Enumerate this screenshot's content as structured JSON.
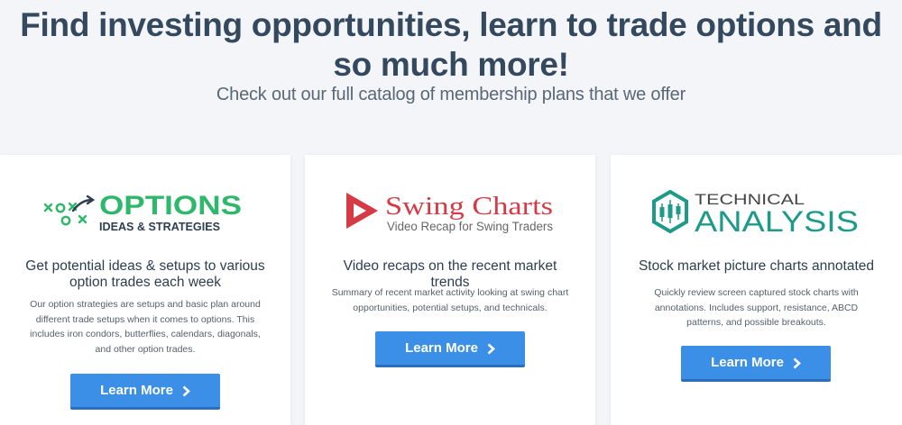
{
  "hero": {
    "headline": "Find investing opportunities, learn to trade options and so much more!",
    "subheadline": "Check out our full catalog of membership plans that we offer"
  },
  "plans": [
    {
      "logo": {
        "word": "OPTIONS",
        "tagline": "IDEAS & STRATEGIES",
        "word_color": "#2fb86b",
        "tagline_color": "#2c3e50",
        "icon": "xo-play-icon"
      },
      "title": "Get potential ideas & setups to various option trades each week",
      "description": "Our option strategies are setups and basic plan around different trade setups when it comes to options. This includes iron condors, butterflies, calendars, diagonals, and other option trades.",
      "button_label": "Learn More"
    },
    {
      "logo": {
        "word": "Swing Charts",
        "tagline": "Video Recap for Swing Traders",
        "word_color": "#d63a44",
        "tagline_color": "#666666",
        "icon": "play-icon"
      },
      "title": "Video recaps on the recent market trends",
      "description": "Summary of recent market activity looking at swing chart opportunities, potential setups, and technicals.",
      "button_label": "Learn More"
    },
    {
      "logo": {
        "word_top": "TECHNICAL",
        "word": "ANALYSIS",
        "word_color": "#1e9a88",
        "top_color": "#444444",
        "icon": "candlestick-hexagon-icon"
      },
      "title": "Stock market picture charts annotated",
      "description": "Quickly review screen captured stock charts with annotations. Includes support, resistance, ABCD patterns, and possible breakouts.",
      "button_label": "Learn More"
    }
  ],
  "colors": {
    "background": "#f3f5f9",
    "headline": "#34495e",
    "button": "#3b8fe6"
  }
}
